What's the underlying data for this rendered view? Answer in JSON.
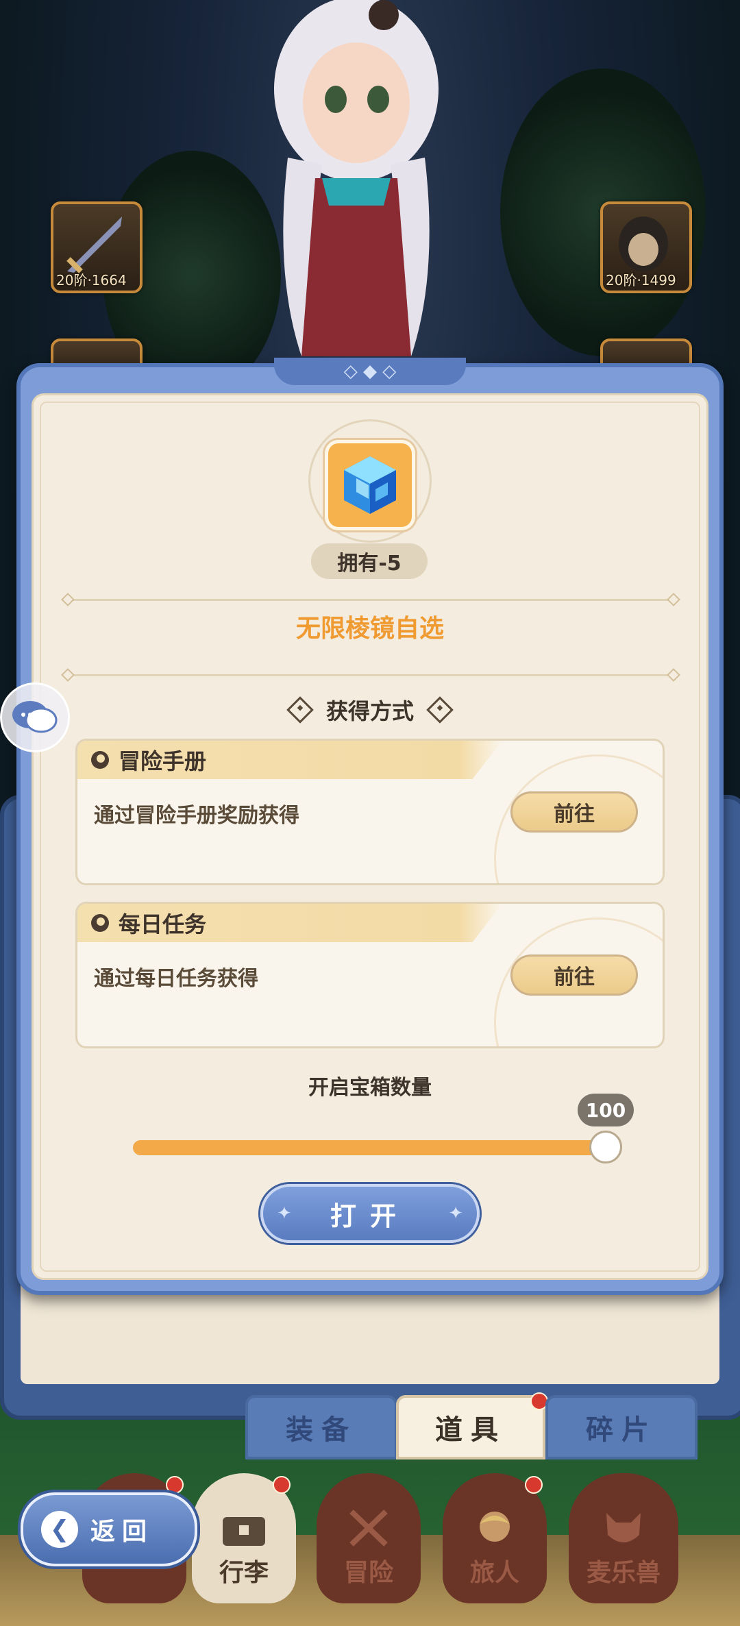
{
  "background": {
    "equip_slots": [
      {
        "name": "sword-slot",
        "level_text": "20阶·1664"
      },
      {
        "name": "helmet-slot",
        "level_text": "20阶·1499"
      }
    ]
  },
  "modal": {
    "top_ornament": "◇ ◆ ◇",
    "owned_text": "拥有-5",
    "item_name": "无限棱镜自选",
    "section_title": "获得方式",
    "sources": [
      {
        "title": "冒险手册",
        "desc": "通过冒险手册奖励获得",
        "button": "前往"
      },
      {
        "title": "每日任务",
        "desc": "通过每日任务获得",
        "button": "前往"
      }
    ],
    "count_label": "开启宝箱数量",
    "slider": {
      "value": "100",
      "min": 0,
      "max": 100,
      "fraction": 1.0
    },
    "open_button": "打开"
  },
  "tabs": [
    {
      "label": "装备",
      "active": false
    },
    {
      "label": "道具",
      "active": true,
      "badge": true
    },
    {
      "label": "碎片",
      "active": false
    }
  ],
  "bottom_nav": [
    {
      "label": "行李",
      "icon": "chest-icon",
      "badge": true
    },
    {
      "label": "冒险",
      "icon": "crossed-swords-icon",
      "badge": false
    },
    {
      "label": "旅人",
      "icon": "traveler-icon",
      "badge": true
    },
    {
      "label": "麦乐兽",
      "icon": "pet-icon",
      "badge": false
    }
  ],
  "back_button": "返回",
  "colors": {
    "accent_orange": "#f09a32",
    "modal_blue": "#7d9cd8",
    "panel_cream": "#f3ecdf",
    "badge_red": "#d8392f"
  }
}
